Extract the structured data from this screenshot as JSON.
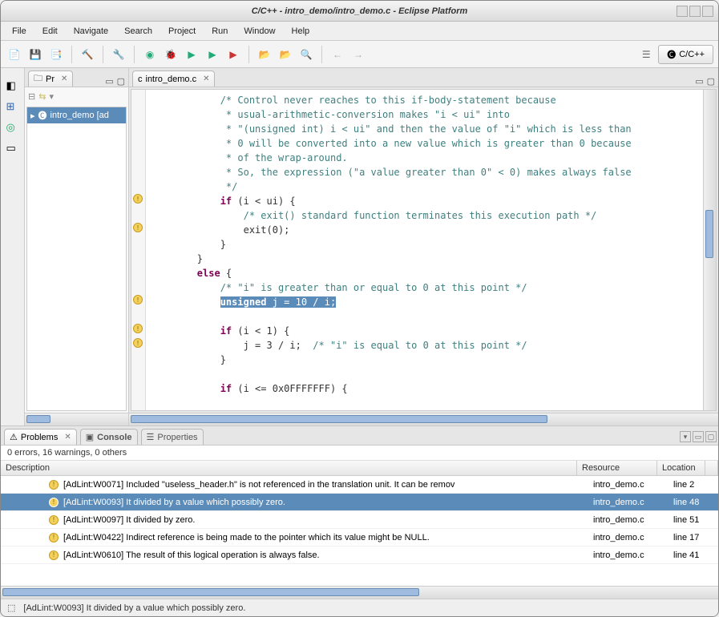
{
  "title": "C/C++ - intro_demo/intro_demo.c - Eclipse Platform",
  "menus": [
    "File",
    "Edit",
    "Navigate",
    "Search",
    "Project",
    "Run",
    "Window",
    "Help"
  ],
  "perspective": "C/C++",
  "project_tab": "Pr",
  "project_item": "intro_demo [ad",
  "editor_tab": "intro_demo.c",
  "code": {
    "c1": "            /* Control never reaches to this if-body-statement because",
    "c2": "             * usual-arithmetic-conversion makes \"i < ui\" into",
    "c3": "             * \"(unsigned int) i < ui\" and then the value of \"i\" which is less than",
    "c4": "             * 0 will be converted into a new value which is greater than 0 because",
    "c5": "             * of the wrap-around.",
    "c6": "             * So, the expression (\"a value greater than 0\" < 0) makes always false",
    "c7": "             */",
    "l8a": "            ",
    "l8b": "if",
    "l8c": " (i < ui) {",
    "c9": "                /* exit() standard function terminates this execution path */",
    "l10": "                exit(0);",
    "l11": "            }",
    "l12": "        }",
    "l13a": "        ",
    "l13b": "else",
    "l13c": " {",
    "c14": "            /* \"i\" is greater than or equal to 0 at this point */",
    "l15a": "            ",
    "l15b": "unsigned",
    "l15c": " j = 10 / i;",
    "l16": "",
    "l17a": "            ",
    "l17b": "if",
    "l17c": " (i < 1) {",
    "l18a": "                j = 3 / i;  ",
    "l18b": "/* \"i\" is equal to 0 at this point */",
    "l19": "            }",
    "l20": "",
    "l21a": "            ",
    "l21b": "if",
    "l21c": " (i <= 0x0FFFFFFF) {"
  },
  "problems_tab": "Problems",
  "console_tab": "Console",
  "properties_tab": "Properties",
  "problems_summary": "0 errors, 16 warnings, 0 others",
  "cols": {
    "desc": "Description",
    "res": "Resource",
    "loc": "Location"
  },
  "rows": [
    {
      "d": "[AdLint:W0071] Included \"useless_header.h\" is not referenced in the translation unit. It can be remov",
      "r": "intro_demo.c",
      "l": "line 2",
      "sel": false
    },
    {
      "d": "[AdLint:W0093] It divided by a value which possibly zero.",
      "r": "intro_demo.c",
      "l": "line 48",
      "sel": true
    },
    {
      "d": "[AdLint:W0097] It divided by zero.",
      "r": "intro_demo.c",
      "l": "line 51",
      "sel": false
    },
    {
      "d": "[AdLint:W0422] Indirect reference is being made to the pointer which its value might be NULL.",
      "r": "intro_demo.c",
      "l": "line 17",
      "sel": false
    },
    {
      "d": "[AdLint:W0610] The result of this logical operation is always false.",
      "r": "intro_demo.c",
      "l": "line 41",
      "sel": false
    }
  ],
  "status": "[AdLint:W0093] It divided by a value which possibly zero."
}
